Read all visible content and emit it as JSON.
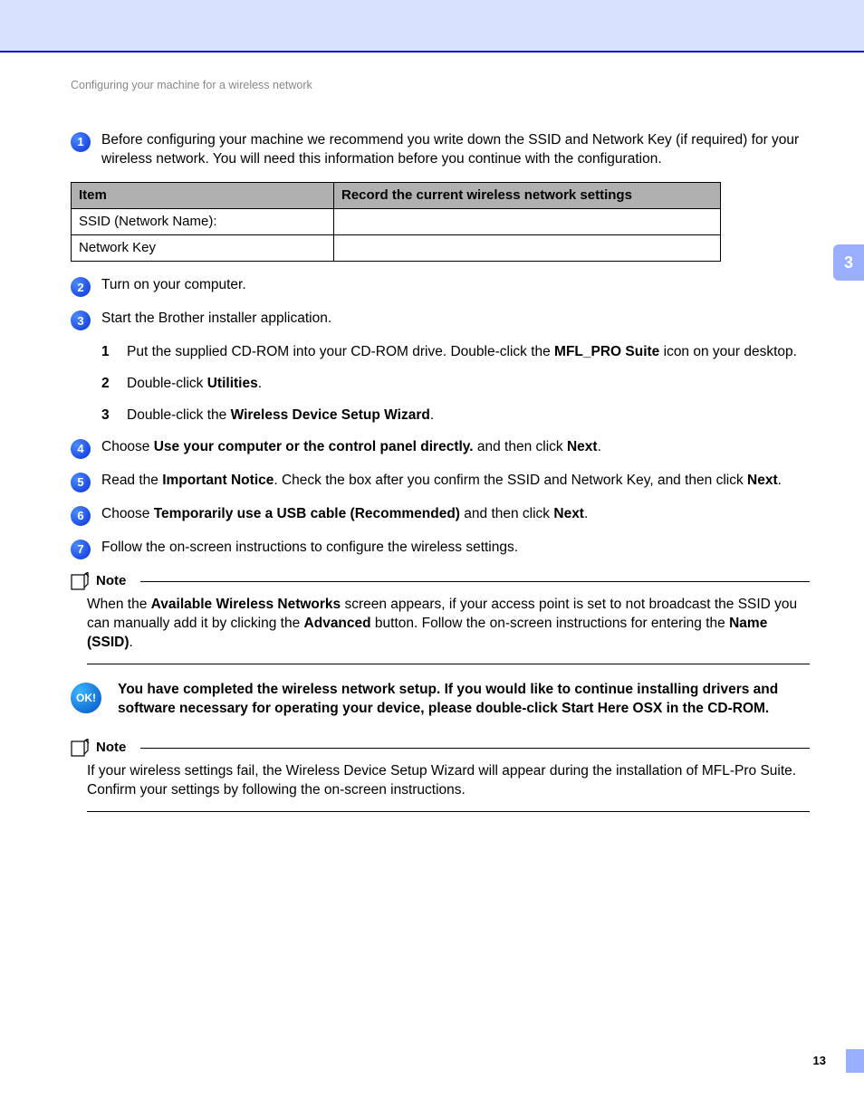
{
  "breadcrumb": "Configuring your machine for a wireless network",
  "sideTabNumber": "3",
  "pageNumber": "13",
  "steps": {
    "s1": {
      "num": "1",
      "text_before": "Before configuring your machine we recommend you write down the SSID and Network Key (if required) for your wireless network. You will need this information before you continue with the configuration."
    },
    "s2": {
      "num": "2",
      "text": "Turn on your computer."
    },
    "s3": {
      "num": "3",
      "text": "Start the Brother installer application.",
      "sub": {
        "a": {
          "num": "1",
          "t1": "Put the supplied CD-ROM into your CD-ROM drive. Double-click the ",
          "b": "MFL_PRO Suite",
          "t2": " icon on your desktop."
        },
        "b": {
          "num": "2",
          "t1": "Double-click ",
          "b": "Utilities",
          "t2": "."
        },
        "c": {
          "num": "3",
          "t1": "Double-click the ",
          "b": "Wireless Device Setup Wizard",
          "t2": "."
        }
      }
    },
    "s4": {
      "num": "4",
      "t1": "Choose ",
      "b1": "Use your computer or the control panel directly.",
      "t2": " and then click ",
      "b2": "Next",
      "t3": "."
    },
    "s5": {
      "num": "5",
      "t1": "Read the ",
      "b1": "Important Notice",
      "t2": ". Check the box after you confirm the SSID and Network Key, and then click ",
      "b2": "Next",
      "t3": "."
    },
    "s6": {
      "num": "6",
      "t1": "Choose ",
      "b1": "Temporarily use a USB cable (Recommended)",
      "t2": " and then click ",
      "b2": "Next",
      "t3": "."
    },
    "s7": {
      "num": "7",
      "text": "Follow the on-screen instructions to configure the wireless settings."
    }
  },
  "table": {
    "h1": "Item",
    "h2": "Record the current wireless network settings",
    "r1": "SSID (Network Name):",
    "r2": "Network Key"
  },
  "note1": {
    "label": "Note",
    "t1": "When the ",
    "b1": "Available Wireless Networks",
    "t2": " screen appears, if your access point is set to not broadcast the SSID you can manually add it by clicking the ",
    "b2": "Advanced",
    "t3": " button. Follow the on-screen instructions for entering the ",
    "b3": "Name (SSID)",
    "t4": "."
  },
  "ok": {
    "badge": "OK!",
    "text": "You have completed the wireless network setup. If you would like to continue installing drivers and software necessary for operating your device, please double-click Start Here OSX in the CD-ROM."
  },
  "note2": {
    "label": "Note",
    "text": "If your wireless settings fail, the Wireless Device Setup Wizard will appear during the installation of MFL-Pro Suite. Confirm your settings by following the on-screen instructions."
  }
}
